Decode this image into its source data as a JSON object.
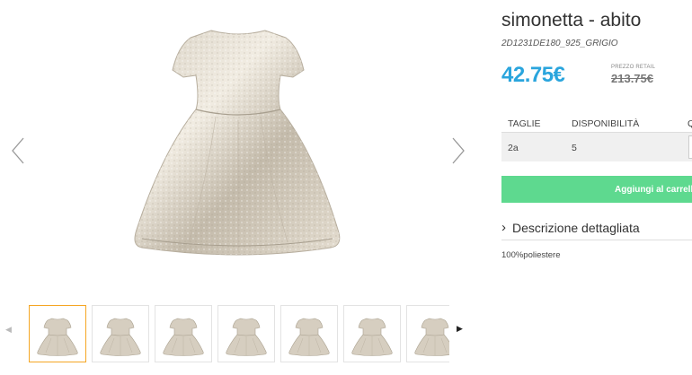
{
  "product": {
    "title": "simonetta - abito",
    "sku": "2D1231DE180_925_GRIGIO",
    "price": "42.75€",
    "retail_label": "PREZZO RETAIL",
    "retail_price": "213.75€"
  },
  "gallery": {
    "main_image": "silver-party-dress-image",
    "prev_icon": "chevron-left-icon",
    "next_icon": "chevron-right-icon",
    "thumbnails": [
      "dress-thumbnail",
      "dress-thumbnail",
      "dress-thumbnail",
      "dress-thumbnail",
      "dress-thumbnail",
      "dress-thumbnail",
      "dress-thumbnail"
    ],
    "selected_index": 0
  },
  "size_table": {
    "headers": [
      "TAGLIE",
      "DISPONIBILITÀ",
      "Q"
    ],
    "rows": [
      {
        "size": "2a",
        "availability": "5"
      }
    ]
  },
  "cart": {
    "button_label": "Aggiungi al carrello"
  },
  "description": {
    "title": "Descrizione dettagliata",
    "text": "100%poliestere"
  },
  "colors": {
    "price": "#2aa5dd",
    "cart_button": "#5ed98f",
    "selected_thumb": "#f5a623"
  }
}
